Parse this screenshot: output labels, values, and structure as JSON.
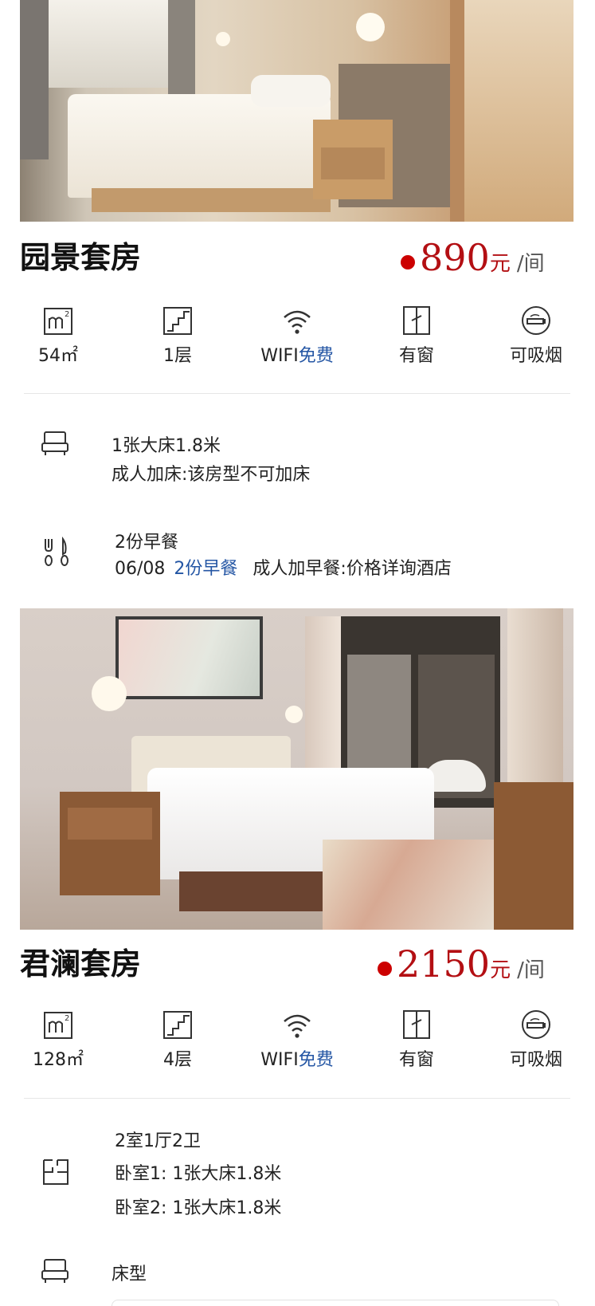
{
  "rooms": [
    {
      "name": "园景套房",
      "price": "890",
      "unit": "元",
      "per": "/间",
      "amenities": {
        "area": "54㎡",
        "floor": "1层",
        "wifi": "WIFI",
        "wifi_note": "免费",
        "window": "有窗",
        "smoking": "可吸烟"
      },
      "bed": {
        "line1": "1张大床1.8米",
        "line2": "成人加床:该房型不可加床"
      },
      "breakfast": {
        "line1": "2份早餐",
        "date": "06/08",
        "link": "2份早餐",
        "extra": "成人加早餐:价格详询酒店"
      }
    },
    {
      "name": "君澜套房",
      "price": "2150",
      "unit": "元",
      "per": "/间",
      "amenities": {
        "area": "128㎡",
        "floor": "4层",
        "wifi": "WIFI",
        "wifi_note": "免费",
        "window": "有窗",
        "smoking": "可吸烟"
      },
      "layout": {
        "line1": "2室1厅2卫",
        "line2": "卧室1: 1张大床1.8米",
        "line3": "卧室2: 1张大床1.8米"
      },
      "bedtype_label": "床型"
    }
  ],
  "icons": [
    "area-icon",
    "floor-icon",
    "wifi-icon",
    "window-icon",
    "smoking-icon",
    "bed-icon",
    "cutlery-icon",
    "floorplan-icon"
  ],
  "colors": {
    "price": "#b30f13",
    "link": "#2456a4"
  }
}
